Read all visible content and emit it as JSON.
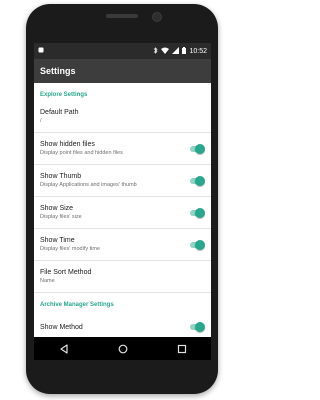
{
  "status_bar": {
    "time": "10:52",
    "icons": [
      "notification-icon",
      "bluetooth-icon",
      "wifi-icon",
      "signal-icon",
      "battery-icon"
    ]
  },
  "app_bar": {
    "title": "Settings"
  },
  "sections": [
    {
      "header": "Explore Settings",
      "items": [
        {
          "title": "Default Path",
          "summary": "/",
          "has_switch": false
        },
        {
          "title": "Show hidden files",
          "summary": "Display point files and hidden files",
          "has_switch": true,
          "checked": true
        },
        {
          "title": "Show Thumb",
          "summary": "Display Applications and images' thumb",
          "has_switch": true,
          "checked": true
        },
        {
          "title": "Show Size",
          "summary": "Display files' size",
          "has_switch": true,
          "checked": true
        },
        {
          "title": "Show Time",
          "summary": "Display files' modify time",
          "has_switch": true,
          "checked": true
        },
        {
          "title": "File Sort Method",
          "summary": "Name",
          "has_switch": false
        }
      ]
    },
    {
      "header": "Archive Manager Settings",
      "items": [
        {
          "title": "Show Method",
          "summary": "",
          "has_switch": true,
          "checked": true
        }
      ]
    }
  ],
  "nav_bar": {
    "icons": [
      "back-icon",
      "home-icon",
      "recents-icon"
    ]
  },
  "colors": {
    "accent": "#2aa58e",
    "app_bar": "#3d3d3d",
    "status_bar": "#2b2b2b"
  }
}
